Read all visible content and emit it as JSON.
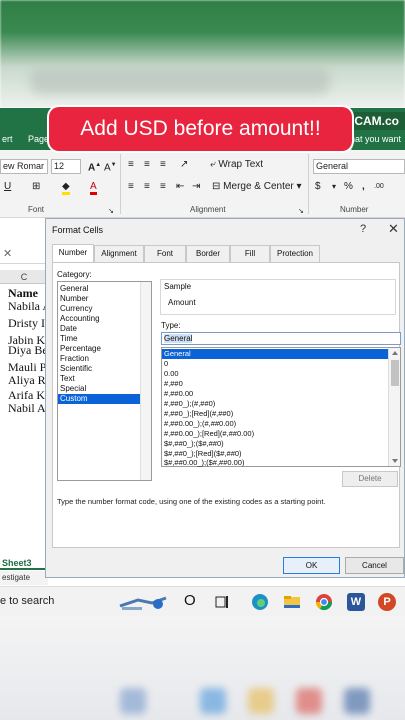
{
  "banner": {
    "text": "Add USD before amount!!"
  },
  "ribbon": {
    "tabs": [
      "ert",
      "Page L"
    ],
    "brand": "DICAM.co",
    "right_text": "hat you want t",
    "font_name": "ew Romar",
    "font_size": "12",
    "number_format": "General",
    "wrap_text": "Wrap Text",
    "merge_center": "Merge & Center",
    "group_font": "Font",
    "group_alignment": "Alignment",
    "group_number": "Number",
    "symbols": {
      "underline": "U",
      "currency": "$",
      "percent": "%",
      "comma": ","
    }
  },
  "sheet": {
    "cancel_mark": "✕",
    "column_header": "C",
    "rows": [
      "Name",
      "Nabila A",
      "Dristy Is",
      "Jabin Kh",
      "Diya Be",
      "Mauli P",
      "Aliya Ra",
      "Arifa Kh",
      "Nabil A"
    ],
    "tab": "Sheet3",
    "status": "estigate"
  },
  "dialog": {
    "title": "Format Cells",
    "help": "?",
    "close": "✕",
    "tabs": [
      "Number",
      "Alignment",
      "Font",
      "Border",
      "Fill",
      "Protection"
    ],
    "active_tab": "Number",
    "category_label": "Category:",
    "categories": [
      "General",
      "Number",
      "Currency",
      "Accounting",
      "Date",
      "Time",
      "Percentage",
      "Fraction",
      "Scientific",
      "Text",
      "Special",
      "Custom"
    ],
    "selected_category": "Custom",
    "sample_label": "Sample",
    "sample_value": "Amount",
    "type_label": "Type:",
    "type_value": "General",
    "types": [
      "General",
      "0",
      "0.00",
      "#,##0",
      "#,##0.00",
      "#,##0_);(#,##0)",
      "#,##0_);[Red](#,##0)",
      "#,##0.00_);(#,##0.00)",
      "#,##0.00_);[Red](#,##0.00)",
      "$#,##0_);($#,##0)",
      "$#,##0_);[Red]($#,##0)",
      "$#,##0.00_);($#,##0.00)"
    ],
    "selected_type": "General",
    "delete_label": "Delete",
    "hint": "Type the number format code, using one of the existing codes as a starting point.",
    "ok_label": "OK",
    "cancel_label": "Cancel"
  },
  "taskbar": {
    "search_text": "e to search",
    "icons": [
      "search-hero-icon",
      "cortana-icon",
      "task-view-icon",
      "edge-icon",
      "file-explorer-icon",
      "chrome-icon",
      "word-icon",
      "powerpoint-icon"
    ],
    "cortana_glyph": "O",
    "word_letter": "W",
    "powerpoint_letter": "P"
  }
}
